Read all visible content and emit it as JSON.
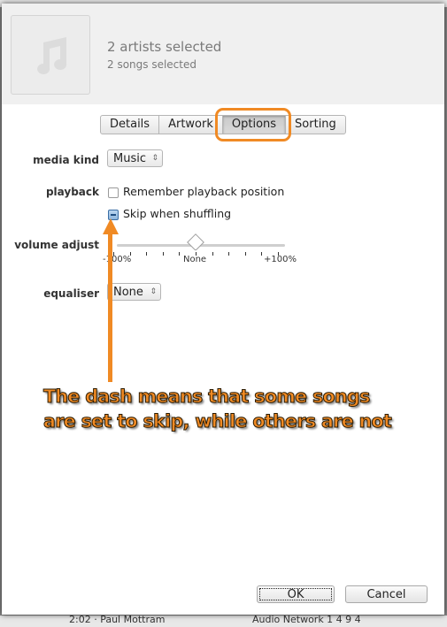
{
  "background": {
    "bottom_left_text": "2:02 · Paul Mottram",
    "bottom_right_text": "Audio Network 1 4 9 4"
  },
  "header": {
    "artwork_icon": "music-note-icon",
    "title": "2 artists selected",
    "subtitle": "2 songs selected"
  },
  "tabs": [
    {
      "label": "Details",
      "active": false
    },
    {
      "label": "Artwork",
      "active": false
    },
    {
      "label": "Options",
      "active": true
    },
    {
      "label": "Sorting",
      "active": false
    }
  ],
  "options": {
    "media_kind": {
      "label": "media kind",
      "value": "Music"
    },
    "playback": {
      "label": "playback",
      "remember_position": {
        "label": "Remember playback position",
        "state": "unchecked"
      },
      "skip_shuffling": {
        "label": "Skip when shuffling",
        "state": "mixed"
      }
    },
    "volume_adjust": {
      "label": "volume adjust",
      "value_percent": 0,
      "tick_labels": [
        "-100%",
        "None",
        "+100%"
      ]
    },
    "equaliser": {
      "label": "equaliser",
      "value": "None"
    }
  },
  "annotation": {
    "text_line1": "The dash means that some songs",
    "text_line2": "are set to skip, while others are not",
    "color": "#f08a24"
  },
  "footer": {
    "ok_label": "OK",
    "cancel_label": "Cancel"
  }
}
